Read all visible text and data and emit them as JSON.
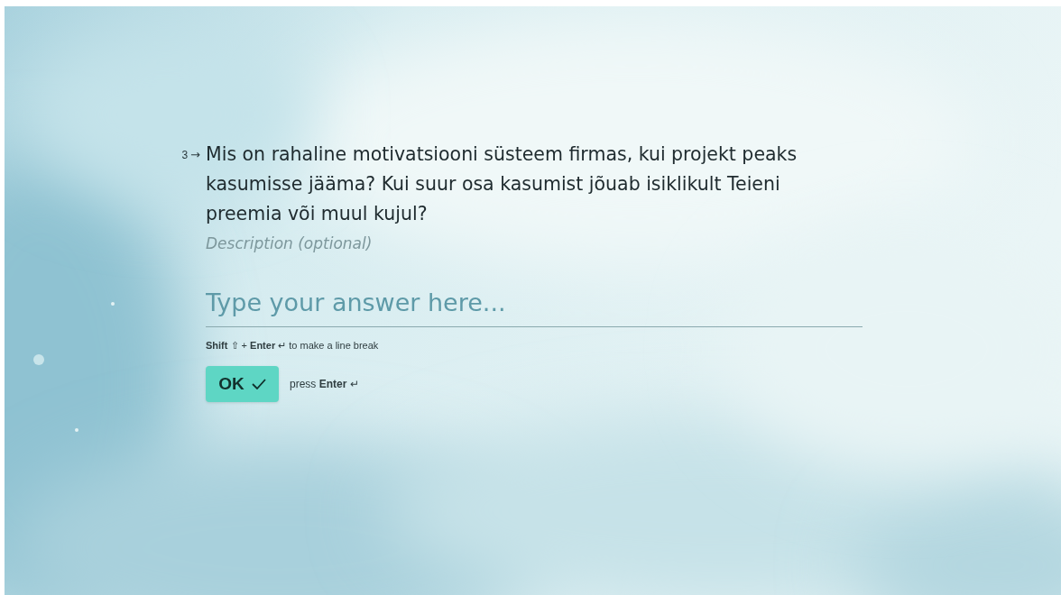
{
  "question": {
    "number": "3",
    "arrow": "→",
    "text": "Mis on rahaline motivatsiooni süsteem firmas, kui projekt peaks kasumisse jääma? Kui suur osa kasumist jõuab isiklikult Teieni preemia või muul kujul?",
    "description": "Description (optional)"
  },
  "answer": {
    "placeholder": "Type your answer here..."
  },
  "hint": "**Shift** ⇧ + **Enter** ↵ to make a line break",
  "ok_button": {
    "label": "OK"
  },
  "enter_hint": "press **Enter** ↵"
}
